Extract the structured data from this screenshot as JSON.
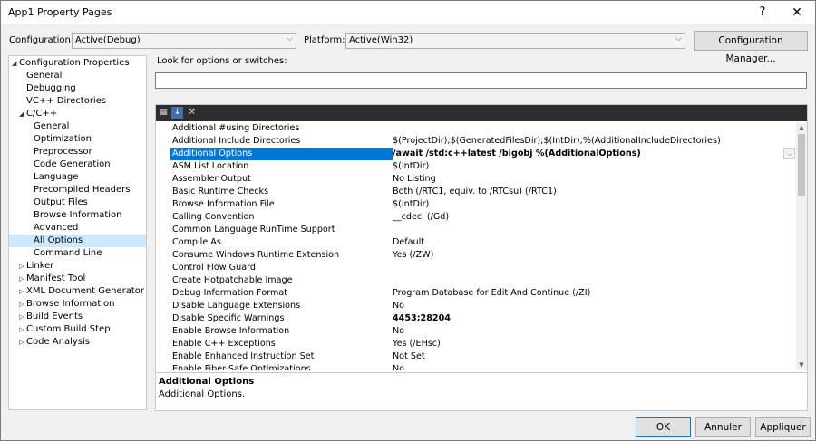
{
  "window": {
    "title": "App1 Property Pages",
    "help_label": "?",
    "close_label": "✕"
  },
  "config": {
    "configuration_label": "Configuration:",
    "configuration_value": "Active(Debug)",
    "platform_label": "Platform:",
    "platform_value": "Active(Win32)",
    "config_manager_label": "Configuration Manager..."
  },
  "tree": {
    "items": [
      {
        "label": "Configuration Properties",
        "expander": "◢"
      },
      {
        "label": "General"
      },
      {
        "label": "Debugging"
      },
      {
        "label": "VC++ Directories"
      },
      {
        "label": "C/C++",
        "expander": "◢"
      },
      {
        "label": "General"
      },
      {
        "label": "Optimization"
      },
      {
        "label": "Preprocessor"
      },
      {
        "label": "Code Generation"
      },
      {
        "label": "Language"
      },
      {
        "label": "Precompiled Headers"
      },
      {
        "label": "Output Files"
      },
      {
        "label": "Browse Information"
      },
      {
        "label": "Advanced"
      },
      {
        "label": "All Options"
      },
      {
        "label": "Command Line"
      },
      {
        "label": "Linker",
        "expander": "▷"
      },
      {
        "label": "Manifest Tool",
        "expander": "▷"
      },
      {
        "label": "XML Document Generator",
        "expander": "▷"
      },
      {
        "label": "Browse Information",
        "expander": "▷"
      },
      {
        "label": "Build Events",
        "expander": "▷"
      },
      {
        "label": "Custom Build Step",
        "expander": "▷"
      },
      {
        "label": "Code Analysis",
        "expander": "▷"
      }
    ]
  },
  "search": {
    "label": "Look for options or switches:",
    "value": ""
  },
  "grid": {
    "rows": [
      {
        "name": "Additional #using Directories",
        "value": ""
      },
      {
        "name": "Additional Include Directories",
        "value": "$(ProjectDir);$(GeneratedFilesDir);$(IntDir);%(AdditionalIncludeDirectories)"
      },
      {
        "name": "Additional Options",
        "value": "/await /std:c++latest /bigobj %(AdditionalOptions)"
      },
      {
        "name": "ASM List Location",
        "value": "$(IntDir)"
      },
      {
        "name": "Assembler Output",
        "value": "No Listing"
      },
      {
        "name": "Basic Runtime Checks",
        "value": "Both (/RTC1, equiv. to /RTCsu) (/RTC1)"
      },
      {
        "name": "Browse Information File",
        "value": "$(IntDir)"
      },
      {
        "name": "Calling Convention",
        "value": "__cdecl (/Gd)"
      },
      {
        "name": "Common Language RunTime Support",
        "value": ""
      },
      {
        "name": "Compile As",
        "value": "Default"
      },
      {
        "name": "Consume Windows Runtime Extension",
        "value": "Yes (/ZW)"
      },
      {
        "name": "Control Flow Guard",
        "value": ""
      },
      {
        "name": "Create Hotpatchable Image",
        "value": ""
      },
      {
        "name": "Debug Information Format",
        "value": "Program Database for Edit And Continue (/ZI)"
      },
      {
        "name": "Disable Language Extensions",
        "value": "No"
      },
      {
        "name": "Disable Specific Warnings",
        "value": "4453;28204"
      },
      {
        "name": "Enable Browse Information",
        "value": "No"
      },
      {
        "name": "Enable C++ Exceptions",
        "value": "Yes (/EHsc)"
      },
      {
        "name": "Enable Enhanced Instruction Set",
        "value": "Not Set"
      },
      {
        "name": "Enable Fiber-Safe Optimizations",
        "value": "No"
      }
    ]
  },
  "description": {
    "title": "Additional Options",
    "text": "Additional Options."
  },
  "buttons": {
    "ok": "OK",
    "cancel": "Annuler",
    "apply": "Appliquer"
  }
}
